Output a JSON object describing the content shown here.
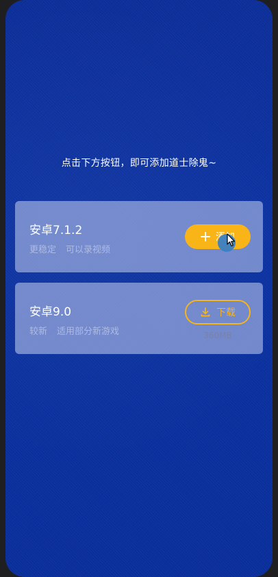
{
  "instruction": "点击下方按钮，即可添加道士除鬼~",
  "versions": [
    {
      "title": "安卓7.1.2",
      "meta": [
        "更稳定",
        "可以录视频"
      ],
      "action_label": "添加",
      "action_icon": "plus-icon"
    },
    {
      "title": "安卓9.0",
      "meta": [
        "较新",
        "适用部分新游戏"
      ],
      "action_label": "下载",
      "action_icon": "download-icon",
      "size": "360MB"
    }
  ],
  "colors": {
    "background": "#0c33a3",
    "accent": "#f9b417",
    "card": "#b1bee6"
  }
}
